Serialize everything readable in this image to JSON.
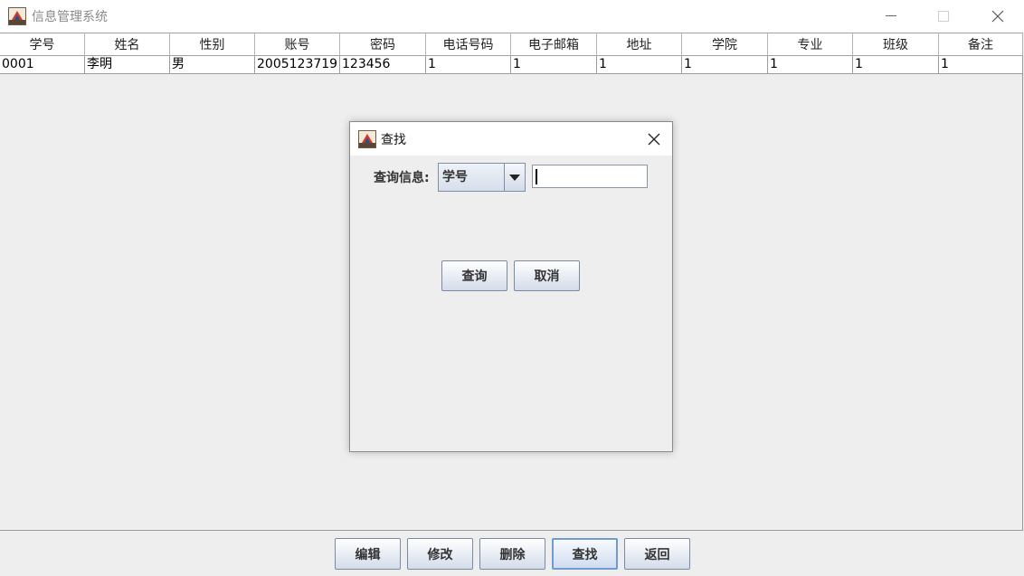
{
  "window": {
    "title": "信息管理系统"
  },
  "table": {
    "columns": [
      "学号",
      "姓名",
      "性别",
      "账号",
      "密码",
      "电话号码",
      "电子邮箱",
      "地址",
      "学院",
      "专业",
      "班级",
      "备注"
    ],
    "rows": [
      [
        "0001",
        "李明",
        "男",
        "2005123719",
        "123456",
        "1",
        "1",
        "1",
        "1",
        "1",
        "1",
        "1"
      ]
    ]
  },
  "toolbar": {
    "edit_label": "编辑",
    "modify_label": "修改",
    "delete_label": "删除",
    "find_label": "查找",
    "back_label": "返回"
  },
  "dialog": {
    "title": "查找",
    "query_label": "查询信息:",
    "field_select": {
      "selected": "学号"
    },
    "search_value": "",
    "query_button": "查询",
    "cancel_button": "取消"
  }
}
